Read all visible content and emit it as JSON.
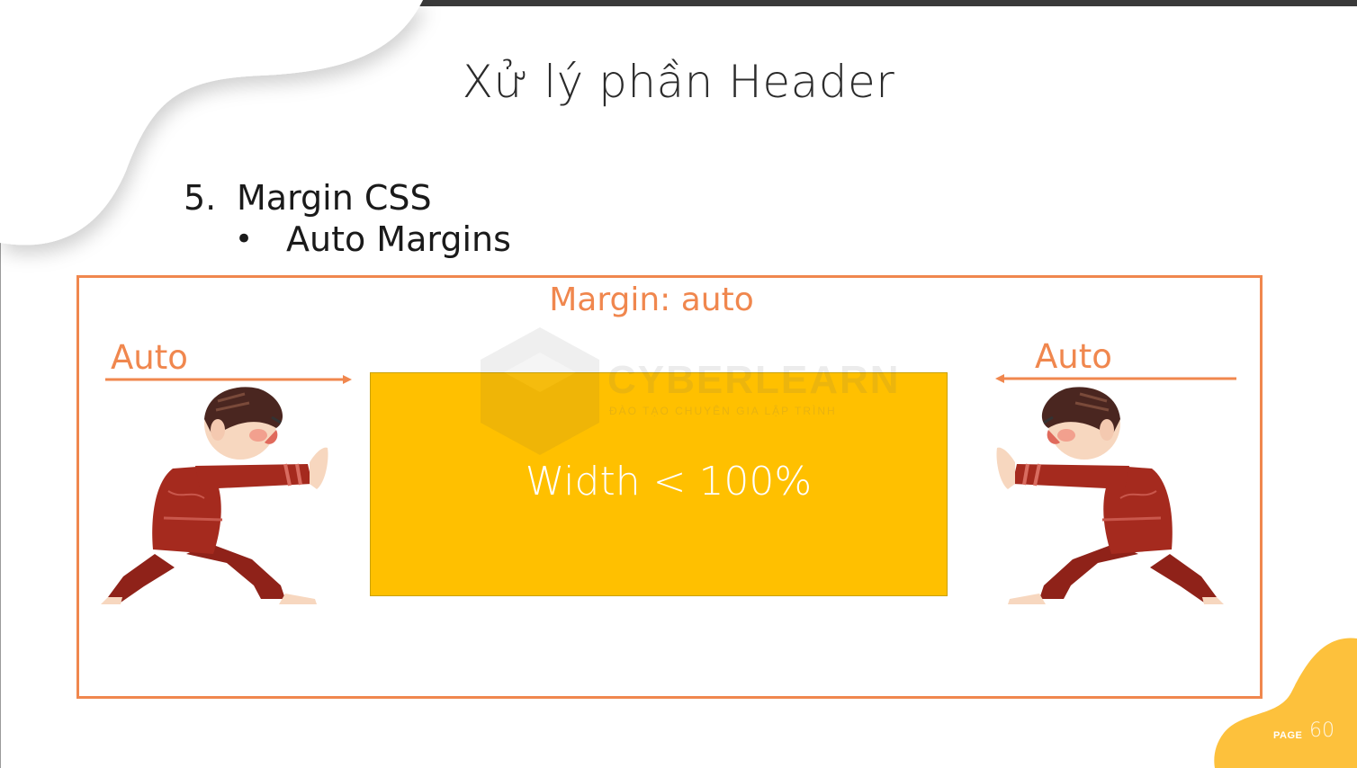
{
  "slide": {
    "title": "Xử lý phần Header",
    "item_number": "5.",
    "item_text": "Margin CSS",
    "bullet": "•",
    "sub_item_text": "Auto Margins"
  },
  "diagram": {
    "margin_label": "Margin: auto",
    "left_label": "Auto",
    "right_label": "Auto",
    "box_label": "Width < 100%"
  },
  "watermark": {
    "brand": "CYBERLEARN",
    "tagline": "ĐÀO TẠO CHUYÊN GIA LẬP TRÌNH"
  },
  "footer": {
    "page_label": "PAGE",
    "page_number": "60"
  },
  "colors": {
    "accent": "#f0874e",
    "box": "#ffc000",
    "corner": "#fdc13c",
    "kid_shirt": "#a52a1e"
  },
  "icons": [
    "left-pushing-kid-illustration",
    "right-pushing-kid-illustration",
    "right-arrow-icon",
    "left-arrow-icon"
  ]
}
